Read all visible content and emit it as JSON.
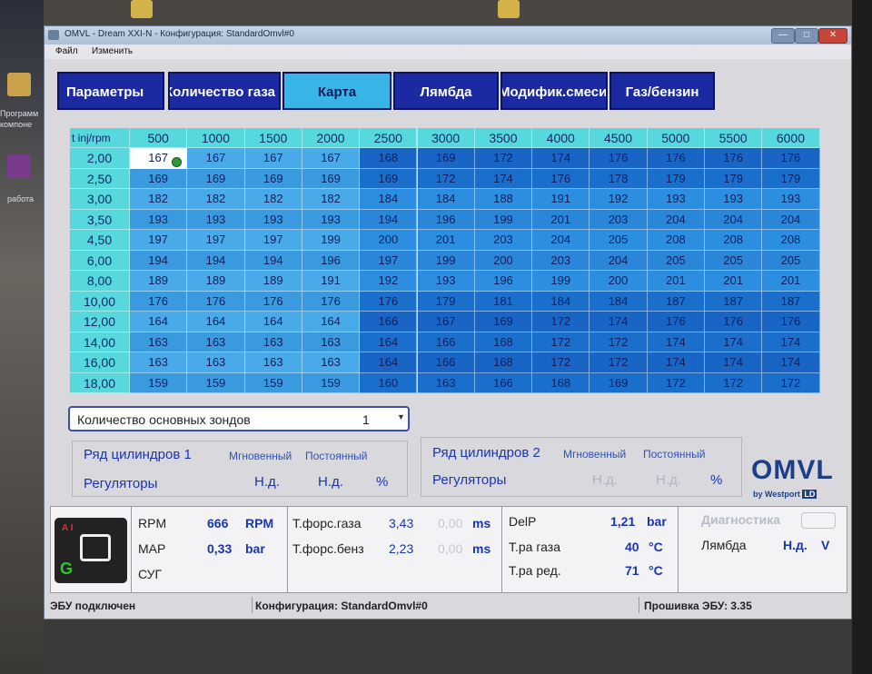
{
  "desktop": {
    "labels": [
      "Программ",
      "компоне",
      "работа"
    ]
  },
  "window": {
    "title": "OMVL - Dream XXI-N - Конфигурация: StandardOmvl#0",
    "minimize": "—",
    "maximize": "□",
    "close": "✕"
  },
  "menu": [
    "Файл",
    "Изменить"
  ],
  "tabs": [
    {
      "label": "Параметры",
      "active": false
    },
    {
      "label": "Количество газа",
      "active": false
    },
    {
      "label": "Карта",
      "active": true
    },
    {
      "label": "Лямбда",
      "active": false
    },
    {
      "label": "Модифик.смеси",
      "active": false
    },
    {
      "label": "Газ/бензин",
      "active": false
    }
  ],
  "map": {
    "corner": "t inj/rpm",
    "rpm": [
      "500",
      "1000",
      "1500",
      "2000",
      "2500",
      "3000",
      "3500",
      "4000",
      "4500",
      "5000",
      "5500",
      "6000"
    ],
    "tinj": [
      "2,00",
      "2,50",
      "3,00",
      "3,50",
      "4,50",
      "6,00",
      "8,00",
      "10,00",
      "12,00",
      "14,00",
      "16,00",
      "18,00"
    ],
    "values": [
      [
        167,
        167,
        167,
        167,
        168,
        169,
        172,
        174,
        176,
        176,
        176,
        176
      ],
      [
        169,
        169,
        169,
        169,
        169,
        172,
        174,
        176,
        178,
        179,
        179,
        179
      ],
      [
        182,
        182,
        182,
        182,
        184,
        184,
        188,
        191,
        192,
        193,
        193,
        193
      ],
      [
        193,
        193,
        193,
        193,
        194,
        196,
        199,
        201,
        203,
        204,
        204,
        204
      ],
      [
        197,
        197,
        197,
        199,
        200,
        201,
        203,
        204,
        205,
        208,
        208,
        208
      ],
      [
        194,
        194,
        194,
        196,
        197,
        199,
        200,
        203,
        204,
        205,
        205,
        205
      ],
      [
        189,
        189,
        189,
        191,
        192,
        193,
        196,
        199,
        200,
        201,
        201,
        201
      ],
      [
        176,
        176,
        176,
        176,
        176,
        179,
        181,
        184,
        184,
        187,
        187,
        187
      ],
      [
        164,
        164,
        164,
        164,
        166,
        167,
        169,
        172,
        174,
        176,
        176,
        176
      ],
      [
        163,
        163,
        163,
        163,
        164,
        166,
        168,
        172,
        172,
        174,
        174,
        174
      ],
      [
        163,
        163,
        163,
        163,
        164,
        166,
        168,
        172,
        172,
        174,
        174,
        174
      ],
      [
        159,
        159,
        159,
        159,
        160,
        163,
        166,
        168,
        169,
        172,
        172,
        172
      ]
    ]
  },
  "sensors": {
    "label": "Количество основных зондов",
    "value": "1"
  },
  "bank1": {
    "title": "Ряд цилиндров 1",
    "col1": "Мгновенный",
    "col2": "Постоянный",
    "row": "Регуляторы",
    "v1": "Н.д.",
    "v2": "Н.д.",
    "unit": "%"
  },
  "bank2": {
    "title": "Ряд цилиндров 2",
    "col1": "Мгновенный",
    "col2": "Постоянный",
    "row": "Регуляторы",
    "v1": "Н.д.",
    "v2": "Н.д.",
    "unit": "%"
  },
  "logo": {
    "text": "OMVL",
    "sub": "by Westport",
    "badge": "LD"
  },
  "ecu_icon": {
    "letters": "A I",
    "g": "G"
  },
  "engine": {
    "rpm_label": "RPM",
    "rpm_value": "666",
    "rpm_unit": "RPM",
    "map_label": "MAP",
    "map_value": "0,33",
    "map_unit": "bar",
    "sug_label": "СУГ"
  },
  "injection": {
    "gas_label": "Т.форс.газа",
    "gas_value": "3,43",
    "gas_value2": "0,00",
    "gas_unit": "ms",
    "petrol_label": "Т.форс.бенз",
    "petrol_value": "2,23",
    "petrol_value2": "0,00",
    "petrol_unit": "ms"
  },
  "sensors_panel": {
    "delp_label": "DelP",
    "delp_value": "1,21",
    "delp_unit": "bar",
    "tgas_label": "Т.ра газа",
    "tgas_value": "40",
    "tgas_unit": "°C",
    "tred_label": "Т.ра ред.",
    "tred_value": "71",
    "tred_unit": "°C"
  },
  "diag": {
    "title": "Диагностика",
    "lambda_label": "Лямбда",
    "lambda_value": "Н.д.",
    "lambda_unit": "V"
  },
  "status": {
    "connection": "ЭБУ подключен",
    "config": "Конфигурация: StandardOmvl#0",
    "firmware": "Прошивка ЭБУ: 3.35"
  },
  "colors": {
    "tab_bg": "#1b2aa0",
    "tab_active": "#38b4e6",
    "header_cyan": "#56d8dc",
    "cell_blue": "#1565c8",
    "cell_light": "#38b0e0",
    "text_blue": "#1a35b0"
  }
}
